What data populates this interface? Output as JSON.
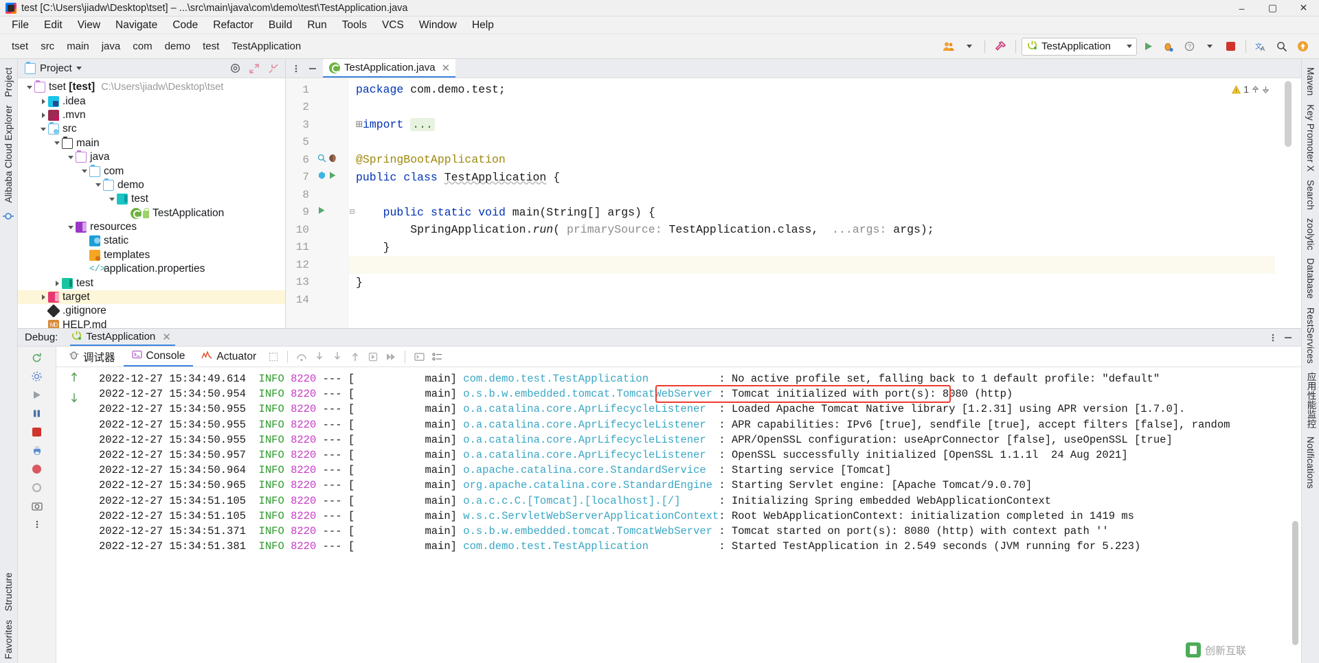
{
  "window": {
    "title": "test [C:\\Users\\jiadw\\Desktop\\tset] – ...\\src\\main\\java\\com\\demo\\test\\TestApplication.java",
    "minimize": "–",
    "maximize": "▢",
    "close": "✕"
  },
  "menubar": {
    "items": [
      {
        "label": "File"
      },
      {
        "label": "Edit"
      },
      {
        "label": "View"
      },
      {
        "label": "Navigate"
      },
      {
        "label": "Code"
      },
      {
        "label": "Refactor"
      },
      {
        "label": "Build"
      },
      {
        "label": "Run"
      },
      {
        "label": "Tools"
      },
      {
        "label": "VCS"
      },
      {
        "label": "Window"
      },
      {
        "label": "Help"
      }
    ]
  },
  "toolbar": {
    "breadcrumbs": [
      "tset",
      "src",
      "main",
      "java",
      "com",
      "demo",
      "test",
      "TestApplication"
    ],
    "run_config": "TestApplication",
    "icons": [
      "user-group-icon",
      "build-hammer-icon",
      "run-icon",
      "debug-icon",
      "help-icon",
      "more-icon",
      "stop-icon",
      "translate-icon",
      "search-icon",
      "updates-icon"
    ]
  },
  "project_panel": {
    "title": "Project",
    "head_icons": [
      "locate-icon",
      "expand-all-icon",
      "collapse-all-icon"
    ],
    "tree": [
      {
        "depth": 0,
        "twist": "down",
        "icon": "folder-project",
        "label": "tset [test]",
        "sub": "C:\\Users\\jiadw\\Desktop\\tset",
        "bold_part": "[test]",
        "hl": false
      },
      {
        "depth": 1,
        "twist": "right",
        "icon": "idea",
        "label": ".idea",
        "sub": "",
        "hl": false
      },
      {
        "depth": 1,
        "twist": "right",
        "icon": "mvn",
        "label": ".mvn",
        "sub": "",
        "hl": false
      },
      {
        "depth": 1,
        "twist": "down",
        "icon": "src",
        "label": "src",
        "sub": "",
        "hl": false
      },
      {
        "depth": 2,
        "twist": "down",
        "icon": "folder-dark",
        "label": "main",
        "sub": "",
        "hl": false
      },
      {
        "depth": 3,
        "twist": "down",
        "icon": "folder-purple",
        "label": "java",
        "sub": "",
        "hl": false
      },
      {
        "depth": 4,
        "twist": "down",
        "icon": "folder-blue",
        "label": "com",
        "sub": "",
        "hl": false
      },
      {
        "depth": 5,
        "twist": "down",
        "icon": "folder-blue",
        "label": "demo",
        "sub": "",
        "hl": false
      },
      {
        "depth": 6,
        "twist": "down",
        "icon": "package-cyan",
        "label": "test",
        "sub": "",
        "hl": false
      },
      {
        "depth": 7,
        "twist": "none",
        "icon": "spring-class",
        "label": "TestApplication",
        "sub": "",
        "hl": false
      },
      {
        "depth": 3,
        "twist": "down",
        "icon": "resources",
        "label": "resources",
        "sub": "",
        "hl": false
      },
      {
        "depth": 4,
        "twist": "none",
        "icon": "static",
        "label": "static",
        "sub": "",
        "hl": false
      },
      {
        "depth": 4,
        "twist": "none",
        "icon": "templates",
        "label": "templates",
        "sub": "",
        "hl": false
      },
      {
        "depth": 4,
        "twist": "none",
        "icon": "properties",
        "label": "application.properties",
        "sub": "",
        "hl": false
      },
      {
        "depth": 2,
        "twist": "right",
        "icon": "test-folder",
        "label": "test",
        "sub": "",
        "hl": false
      },
      {
        "depth": 1,
        "twist": "right",
        "icon": "target",
        "label": "target",
        "sub": "",
        "hl": true
      },
      {
        "depth": 1,
        "twist": "none",
        "icon": "git",
        "label": ".gitignore",
        "sub": "",
        "hl": false
      },
      {
        "depth": 1,
        "twist": "none",
        "icon": "md",
        "label": "HELP.md",
        "sub": "",
        "hl": false
      }
    ]
  },
  "editor": {
    "tab": {
      "label": "TestApplication.java",
      "close": "✕",
      "icon": "spring-file-icon"
    },
    "warning_count": "1",
    "lines": [
      {
        "num": "1",
        "html": "package_line"
      },
      {
        "num": "2",
        "html": "blank"
      },
      {
        "num": "3",
        "html": "import_line"
      },
      {
        "num": "5",
        "html": "blank"
      },
      {
        "num": "6",
        "html": "anno_line"
      },
      {
        "num": "7",
        "html": "class_line"
      },
      {
        "num": "8",
        "html": "blank"
      },
      {
        "num": "9",
        "html": "main_line"
      },
      {
        "num": "10",
        "html": "run_line"
      },
      {
        "num": "11",
        "html": "close_brace_inner"
      },
      {
        "num": "12",
        "html": "blank"
      },
      {
        "num": "13",
        "html": "close_brace_outer"
      },
      {
        "num": "14",
        "html": "blank"
      }
    ],
    "text": {
      "package_kw": "package",
      "package_name": " com.demo.test;",
      "import_kw": "import",
      "import_ellipsis": "...",
      "annotation": "@SpringBootApplication",
      "public_kw": "public",
      "class_kw": "class",
      "class_name": "TestApplication",
      "brace_open": "{",
      "static_kw": "static",
      "void_kw": "void",
      "main_name": "main",
      "main_params_open": "(",
      "string_type": "String",
      "brackets": "[]",
      "args_param": " args",
      "main_params_close": ") {",
      "spring_app": "SpringApplication.",
      "run_method": "run",
      "run_paren_open": "( ",
      "hint_primary": "primarySource:",
      "run_arg1": " TestApplication.class,",
      "hint_args": "  ...args:",
      "run_arg2": " args);",
      "brace_close": "}"
    }
  },
  "debug": {
    "label": "Debug:",
    "session": "TestApplication",
    "close": "✕",
    "tabs": [
      {
        "label": "调试器",
        "icon": "debugger-icon",
        "active": false
      },
      {
        "label": "Console",
        "icon": "console-icon",
        "active": true
      },
      {
        "label": "Actuator",
        "icon": "actuator-icon",
        "active": false
      }
    ],
    "toolbar_icons": [
      "rerun-icon",
      "step-over-icon",
      "step-into-icon",
      "step-out-icon",
      "run-to-cursor-icon",
      "resume-icon",
      "evaluate-icon",
      "settings-list-icon"
    ],
    "side_icons": [
      "rerun-icon",
      "settings-icon",
      "resume-icon",
      "pause-icon",
      "stop-icon",
      "print-icon",
      "breakpoint-icon",
      "mute-breakpoints-icon",
      "camera-icon",
      "more-icon"
    ],
    "highlight_box_line": 1
  },
  "console": {
    "lines": [
      {
        "ts": "2022-12-27 15:34:49.614",
        "level": "INFO",
        "pid": "8220",
        "dash": "---",
        "thread": "[           main]",
        "logger": "com.demo.test.TestApplication",
        "sep": ":",
        "msg": " No active profile set, falling back to 1 default profile: \"default\""
      },
      {
        "ts": "2022-12-27 15:34:50.954",
        "level": "INFO",
        "pid": "8220",
        "dash": "---",
        "thread": "[           main]",
        "logger": "o.s.b.w.embedded.tomcat.TomcatWebServer",
        "sep": ":",
        "msg": " Tomcat initialized with port(s): 8080 (http)"
      },
      {
        "ts": "2022-12-27 15:34:50.955",
        "level": "INFO",
        "pid": "8220",
        "dash": "---",
        "thread": "[           main]",
        "logger": "o.a.catalina.core.AprLifecycleListener",
        "sep": ":",
        "msg": " Loaded Apache Tomcat Native library [1.2.31] using APR version [1.7.0]."
      },
      {
        "ts": "2022-12-27 15:34:50.955",
        "level": "INFO",
        "pid": "8220",
        "dash": "---",
        "thread": "[           main]",
        "logger": "o.a.catalina.core.AprLifecycleListener",
        "sep": ":",
        "msg": " APR capabilities: IPv6 [true], sendfile [true], accept filters [false], random"
      },
      {
        "ts": "2022-12-27 15:34:50.955",
        "level": "INFO",
        "pid": "8220",
        "dash": "---",
        "thread": "[           main]",
        "logger": "o.a.catalina.core.AprLifecycleListener",
        "sep": ":",
        "msg": " APR/OpenSSL configuration: useAprConnector [false], useOpenSSL [true]"
      },
      {
        "ts": "2022-12-27 15:34:50.957",
        "level": "INFO",
        "pid": "8220",
        "dash": "---",
        "thread": "[           main]",
        "logger": "o.a.catalina.core.AprLifecycleListener",
        "sep": ":",
        "msg": " OpenSSL successfully initialized [OpenSSL 1.1.1l  24 Aug 2021]"
      },
      {
        "ts": "2022-12-27 15:34:50.964",
        "level": "INFO",
        "pid": "8220",
        "dash": "---",
        "thread": "[           main]",
        "logger": "o.apache.catalina.core.StandardService",
        "sep": ":",
        "msg": " Starting service [Tomcat]"
      },
      {
        "ts": "2022-12-27 15:34:50.965",
        "level": "INFO",
        "pid": "8220",
        "dash": "---",
        "thread": "[           main]",
        "logger": "org.apache.catalina.core.StandardEngine",
        "sep": ":",
        "msg": " Starting Servlet engine: [Apache Tomcat/9.0.70]"
      },
      {
        "ts": "2022-12-27 15:34:51.105",
        "level": "INFO",
        "pid": "8220",
        "dash": "---",
        "thread": "[           main]",
        "logger": "o.a.c.c.C.[Tomcat].[localhost].[/]",
        "sep": ":",
        "msg": " Initializing Spring embedded WebApplicationContext"
      },
      {
        "ts": "2022-12-27 15:34:51.105",
        "level": "INFO",
        "pid": "8220",
        "dash": "---",
        "thread": "[           main]",
        "logger": "w.s.c.ServletWebServerApplicationContext",
        "sep": ":",
        "msg": " Root WebApplicationContext: initialization completed in 1419 ms"
      },
      {
        "ts": "2022-12-27 15:34:51.371",
        "level": "INFO",
        "pid": "8220",
        "dash": "---",
        "thread": "[           main]",
        "logger": "o.s.b.w.embedded.tomcat.TomcatWebServer",
        "sep": ":",
        "msg": " Tomcat started on port(s): 8080 (http) with context path ''"
      },
      {
        "ts": "2022-12-27 15:34:51.381",
        "level": "INFO",
        "pid": "8220",
        "dash": "---",
        "thread": "[           main]",
        "logger": "com.demo.test.TestApplication",
        "sep": ":",
        "msg": " Started TestApplication in 2.549 seconds (JVM running for 5.223)"
      }
    ]
  },
  "left_strip": {
    "items": [
      {
        "label": "Project"
      },
      {
        "label": "Alibaba Cloud Explorer"
      },
      {
        "label": "Structure"
      },
      {
        "label": "Favorites"
      }
    ]
  },
  "right_strip": {
    "items": [
      {
        "label": "Maven"
      },
      {
        "label": "Key Promoter X"
      },
      {
        "label": "Search"
      },
      {
        "label": "zoolytic"
      },
      {
        "label": "Database"
      },
      {
        "label": "RestServices"
      },
      {
        "label": "应用性能监控"
      },
      {
        "label": "Notifications"
      }
    ]
  },
  "watermark": {
    "text": "创新互联"
  },
  "colors": {
    "accent": "#3c86e0",
    "keyword": "#0033b3",
    "string": "#067d17",
    "annotation": "#9e880d",
    "log_level": "#2d9c2d",
    "log_pid": "#c838c8",
    "log_logger": "#3aa6c4",
    "highlight_box": "#ef3b2d",
    "tree_highlight": "#fdf6d8"
  }
}
